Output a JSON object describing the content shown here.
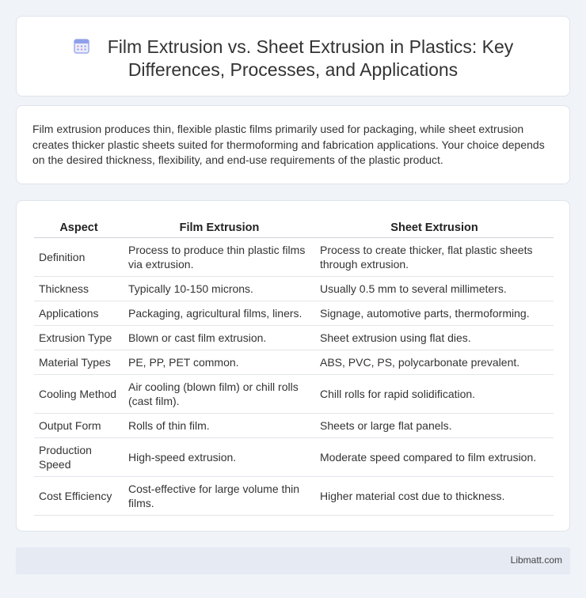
{
  "header": {
    "title": "Film Extrusion vs. Sheet Extrusion in Plastics: Key Differences, Processes, and Applications",
    "icon": "calendar-icon",
    "accent": "#7b8fe0"
  },
  "intro": {
    "text": "Film extrusion produces thin, flexible plastic films primarily used for packaging, while sheet extrusion creates thicker plastic sheets suited for thermoforming and fabrication applications. Your choice depends on the desired thickness, flexibility, and end-use requirements of the plastic product."
  },
  "table": {
    "headers": [
      "Aspect",
      "Film Extrusion",
      "Sheet Extrusion"
    ],
    "rows": [
      [
        "Definition",
        "Process to produce thin plastic films via extrusion.",
        "Process to create thicker, flat plastic sheets through extrusion."
      ],
      [
        "Thickness",
        "Typically 10-150 microns.",
        "Usually 0.5 mm to several millimeters."
      ],
      [
        "Applications",
        "Packaging, agricultural films, liners.",
        "Signage, automotive parts, thermoforming."
      ],
      [
        "Extrusion Type",
        "Blown or cast film extrusion.",
        "Sheet extrusion using flat dies."
      ],
      [
        "Material Types",
        "PE, PP, PET common.",
        "ABS, PVC, PS, polycarbonate prevalent."
      ],
      [
        "Cooling Method",
        "Air cooling (blown film) or chill rolls (cast film).",
        "Chill rolls for rapid solidification."
      ],
      [
        "Output Form",
        "Rolls of thin film.",
        "Sheets or large flat panels."
      ],
      [
        "Production Speed",
        "High-speed extrusion.",
        "Moderate speed compared to film extrusion."
      ],
      [
        "Cost Efficiency",
        "Cost-effective for large volume thin films.",
        "Higher material cost due to thickness."
      ]
    ]
  },
  "footer": {
    "site": "Libmatt.com"
  }
}
